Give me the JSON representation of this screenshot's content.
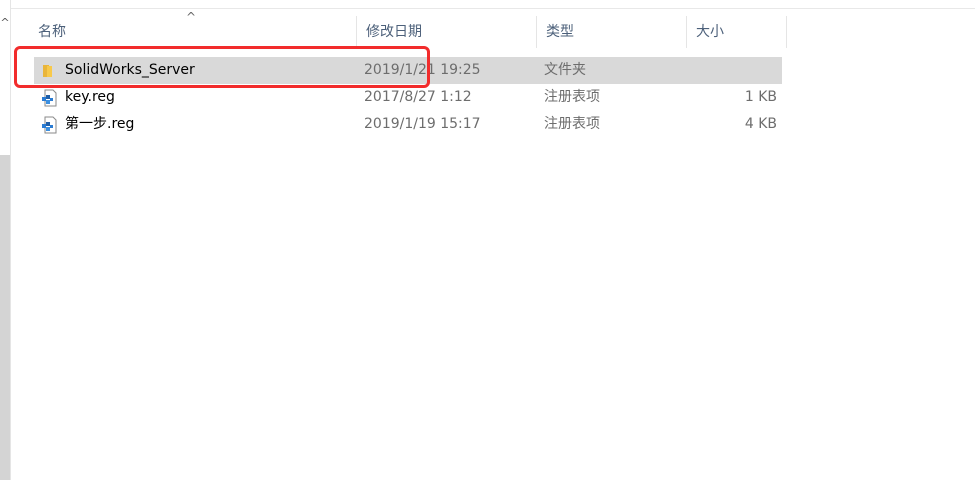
{
  "header": {
    "columns": [
      "名称",
      "修改日期",
      "类型",
      "大小"
    ],
    "sort_arrow": "^"
  },
  "nav": {
    "scroll_up": "^"
  },
  "files": [
    {
      "name": "SolidWorks_Server",
      "date": "2019/1/21 19:25",
      "type": "文件夹",
      "size": "",
      "icon": "folder-icon",
      "selected": true
    },
    {
      "name": "key.reg",
      "date": "2017/8/27 1:12",
      "type": "注册表项",
      "size": "1 KB",
      "icon": "registry-file-icon",
      "selected": false
    },
    {
      "name": "第一步.reg",
      "date": "2019/1/19 15:17",
      "type": "注册表项",
      "size": "4 KB",
      "icon": "registry-file-icon",
      "selected": false
    }
  ],
  "colors": {
    "annotation": "#f22c2c",
    "selection": "#d9d9d9",
    "folder": "#f8c94a",
    "header_text": "#4c607a"
  }
}
